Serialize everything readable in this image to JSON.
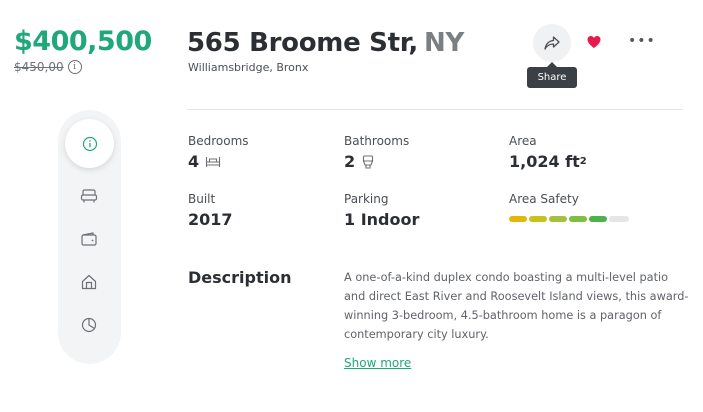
{
  "price": {
    "current": "$400,500",
    "previous": "$450,00",
    "info_icon": "info-icon"
  },
  "listing": {
    "street": "565 Broome Str,",
    "state": "NY",
    "neighborhood": "Williamsbridge, Bronx"
  },
  "actions": {
    "share_icon": "share-icon",
    "share_tooltip": "Share",
    "favorite_icon": "heart-icon",
    "favorite_color": "#e8194b",
    "more_icon": "more-icon",
    "more_glyph": "•••"
  },
  "sidenav": {
    "items": [
      {
        "icon": "info-icon",
        "active": true
      },
      {
        "icon": "sofa-icon",
        "active": false
      },
      {
        "icon": "wallet-icon",
        "active": false
      },
      {
        "icon": "home-icon",
        "active": false
      },
      {
        "icon": "pie-chart-icon",
        "active": false
      }
    ]
  },
  "stats": {
    "bedrooms": {
      "label": "Bedrooms",
      "value": "4",
      "icon": "bed-icon"
    },
    "bathrooms": {
      "label": "Bathrooms",
      "value": "2",
      "icon": "toilet-icon"
    },
    "area": {
      "label": "Area",
      "value": "1,024 ft",
      "unit_sup": "2"
    },
    "built": {
      "label": "Built",
      "value": "2017"
    },
    "parking": {
      "label": "Parking",
      "value": "1 Indoor"
    },
    "area_safety": {
      "label": "Area Safety",
      "level": 5,
      "max": 6,
      "segment_colors": [
        "#e3b708",
        "#c9c21a",
        "#a3c13a",
        "#7fbe3e",
        "#4cb348",
        "#e5e6e7"
      ]
    }
  },
  "description": {
    "heading": "Description",
    "text": "A one-of-a-kind duplex condo boasting a multi-level patio and direct East River and Roosevelt Island views, this award-winning 3-bedroom, 4.5-bathroom home is a paragon of contemporary city luxury.",
    "show_more": "Show more"
  },
  "colors": {
    "accent": "#20a77a",
    "text_primary": "#2b2f33",
    "text_secondary": "#5f6368"
  }
}
